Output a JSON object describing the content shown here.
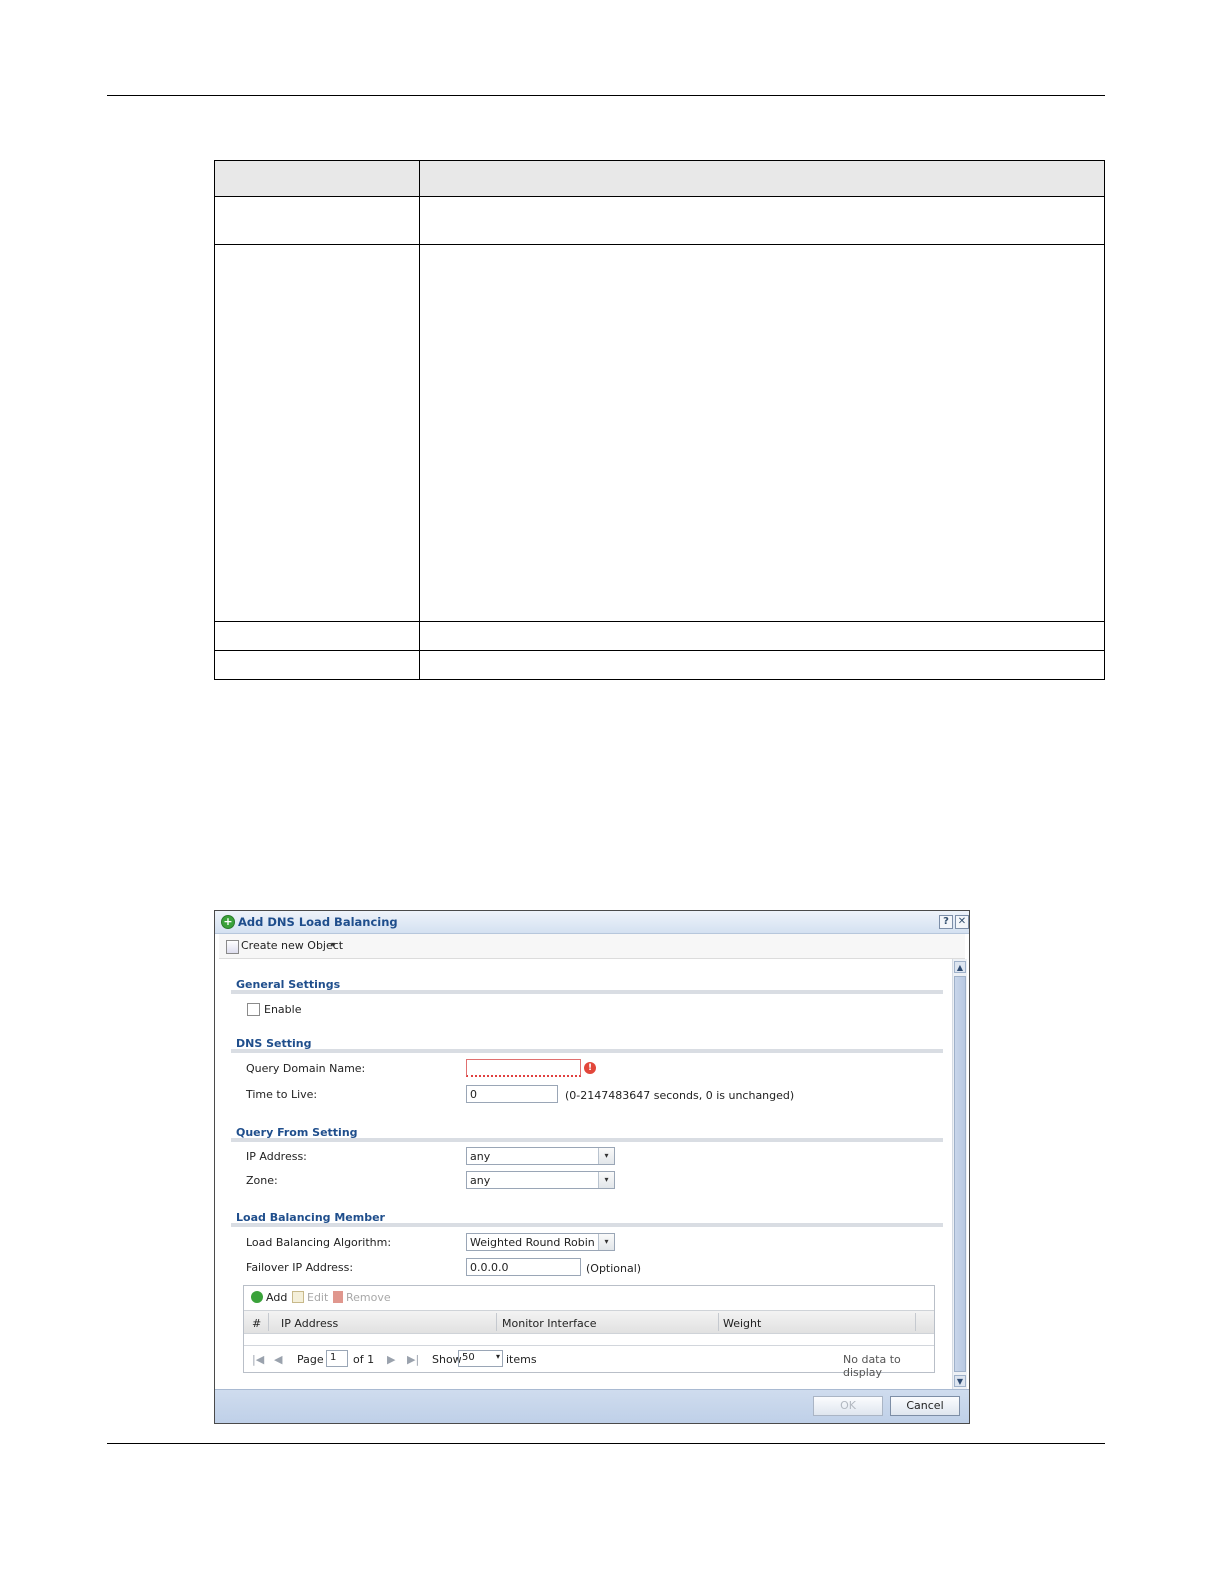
{
  "dialog": {
    "title": "Add DNS Load Balancing",
    "help_glyph": "?",
    "close_glyph": "✕",
    "menu": {
      "create_label": "Create new Object",
      "caret": "▾"
    },
    "general": {
      "heading": "General Settings",
      "enable_label": "Enable"
    },
    "dns": {
      "heading": "DNS Setting",
      "query_domain_label": "Query Domain Name:",
      "query_domain_value": "",
      "error_glyph": "!",
      "ttl_label": "Time to Live:",
      "ttl_value": "0",
      "ttl_hint": "(0-2147483647 seconds, 0 is unchanged)"
    },
    "query_from": {
      "heading": "Query From Setting",
      "ip_label": "IP Address:",
      "ip_value": "any",
      "zone_label": "Zone:",
      "zone_value": "any"
    },
    "lb_member": {
      "heading": "Load Balancing Member",
      "algo_label": "Load Balancing Algorithm:",
      "algo_value": "Weighted Round Robin",
      "failover_label": "Failover IP Address:",
      "failover_value": "0.0.0.0",
      "failover_hint": "(Optional)"
    },
    "grid": {
      "add_label": "Add",
      "edit_label": "Edit",
      "remove_label": "Remove",
      "columns": [
        "#",
        "IP Address",
        "Monitor Interface",
        "Weight"
      ],
      "pager": {
        "page_label": "Page",
        "page_value": "1",
        "of_label": "of 1",
        "show_label": "Show",
        "show_value": "50",
        "items_label": "items",
        "status": "No data to display"
      }
    },
    "footer": {
      "ok_label": "OK",
      "cancel_label": "Cancel"
    },
    "arrow_glyph": "▾"
  }
}
